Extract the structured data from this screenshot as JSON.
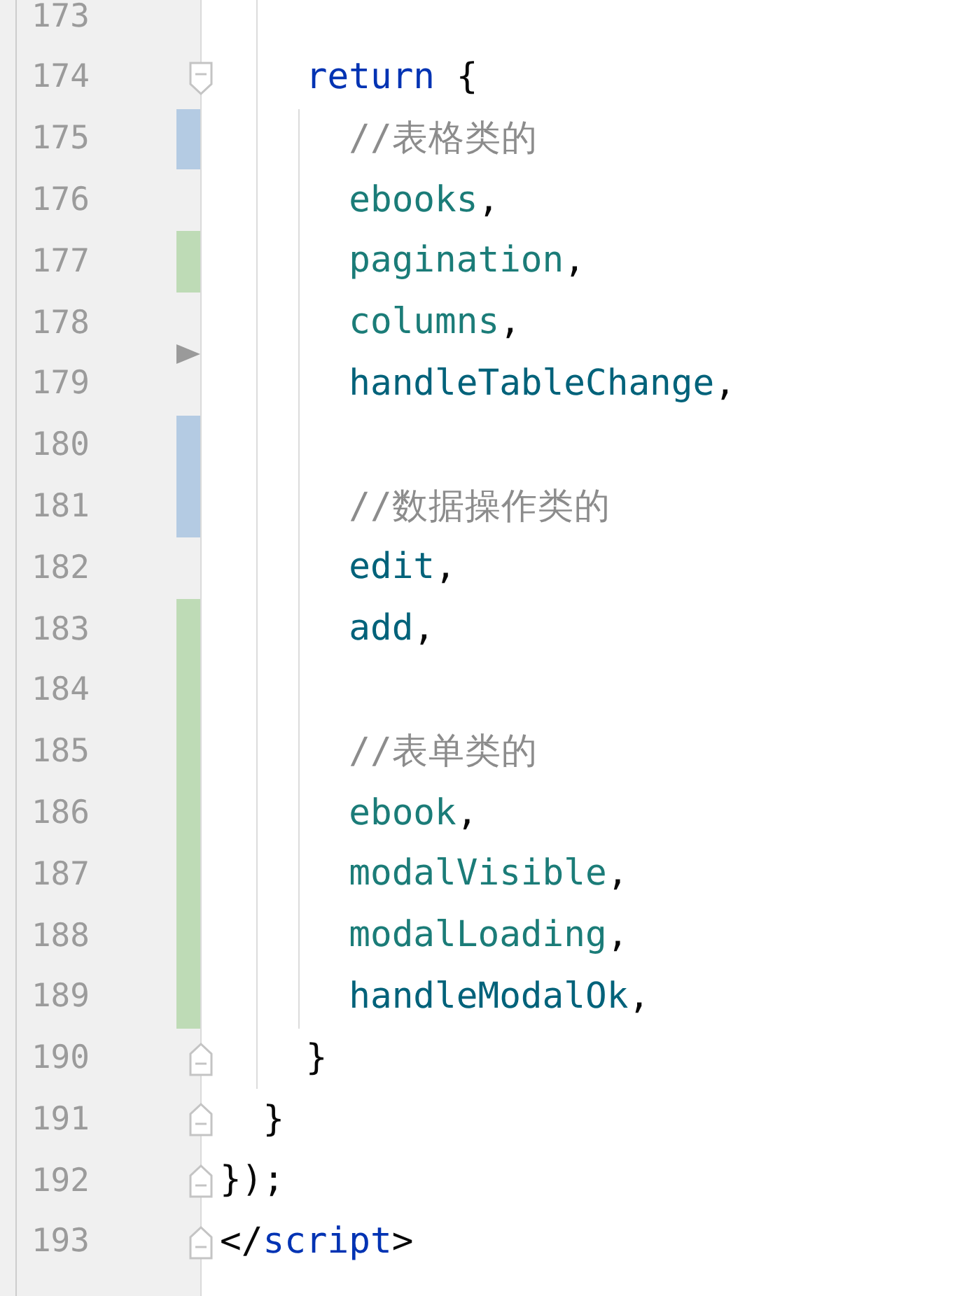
{
  "lines": [
    {
      "children": [
        {
          "children": [
            {
              "number": "173",
              "kind": "plain"
            },
            {
              "number": "174",
              "kind": "foldstart",
              "tokens": [
                {
                  "kind": "keyword",
                  "text": "return"
                },
                {
                  "kind": "plain",
                  "text": " {"
                }
              ],
              "children": [
                {
                  "number": "175",
                  "kind": "modified",
                  "tokens": [
                    {
                      "kind": "comment",
                      "text": "//表格类的"
                    }
                  ]
                },
                {
                  "number": "176",
                  "kind": "plain",
                  "tokens": [
                    {
                      "kind": "variable",
                      "text": "ebooks"
                    },
                    {
                      "kind": "plain",
                      "text": ","
                    }
                  ]
                },
                {
                  "number": "177",
                  "kind": "added",
                  "tokens": [
                    {
                      "kind": "variable",
                      "text": "pagination"
                    },
                    {
                      "kind": "plain",
                      "text": ","
                    }
                  ]
                },
                {
                  "number": "178",
                  "kind": "deleted",
                  "tokens": [
                    {
                      "kind": "variable",
                      "text": "columns"
                    },
                    {
                      "kind": "plain",
                      "text": ","
                    }
                  ]
                },
                {
                  "number": "179",
                  "kind": "plain",
                  "tokens": [
                    {
                      "kind": "function",
                      "text": "handleTableChange"
                    },
                    {
                      "kind": "plain",
                      "text": ","
                    }
                  ]
                },
                {
                  "number": "180",
                  "kind": "modified"
                },
                {
                  "number": "181",
                  "kind": "modified",
                  "tokens": [
                    {
                      "kind": "comment",
                      "text": "//数据操作类的"
                    }
                  ]
                },
                {
                  "number": "182",
                  "kind": "plain",
                  "tokens": [
                    {
                      "kind": "function",
                      "text": "edit"
                    },
                    {
                      "kind": "plain",
                      "text": ","
                    }
                  ]
                },
                {
                  "number": "183",
                  "kind": "added",
                  "tokens": [
                    {
                      "kind": "function",
                      "text": "add"
                    },
                    {
                      "kind": "plain",
                      "text": ","
                    }
                  ]
                },
                {
                  "number": "184",
                  "kind": "added"
                },
                {
                  "number": "185",
                  "kind": "added",
                  "tokens": [
                    {
                      "kind": "comment",
                      "text": "//表单类的"
                    }
                  ]
                },
                {
                  "number": "186",
                  "kind": "added",
                  "tokens": [
                    {
                      "kind": "variable",
                      "text": "ebook"
                    },
                    {
                      "kind": "plain",
                      "text": ","
                    }
                  ]
                },
                {
                  "number": "187",
                  "kind": "added",
                  "tokens": [
                    {
                      "kind": "variable",
                      "text": "modalVisible"
                    },
                    {
                      "kind": "plain",
                      "text": ","
                    }
                  ]
                },
                {
                  "number": "188",
                  "kind": "added",
                  "tokens": [
                    {
                      "kind": "variable",
                      "text": "modalLoading"
                    },
                    {
                      "kind": "plain",
                      "text": ","
                    }
                  ]
                },
                {
                  "number": "189",
                  "kind": "added",
                  "tokens": [
                    {
                      "kind": "function",
                      "text": "handleModalOk"
                    },
                    {
                      "kind": "plain",
                      "text": ","
                    }
                  ]
                }
              ]
            },
            {
              "number": "190",
              "kind": "foldend",
              "tokens": [
                {
                  "kind": "plain",
                  "text": "}"
                }
              ]
            }
          ]
        },
        {
          "number": "191",
          "kind": "foldend",
          "tokens": [
            {
              "kind": "plain",
              "text": "}"
            }
          ]
        }
      ]
    },
    {
      "number": "192",
      "kind": "foldend",
      "tokens": [
        {
          "kind": "plain",
          "text": "});"
        }
      ]
    },
    {
      "number": "193",
      "kind": "foldend",
      "tokens": [
        {
          "kind": "plain",
          "text": "</"
        },
        {
          "kind": "tag",
          "text": "script"
        },
        {
          "kind": "plain",
          "text": ">"
        }
      ]
    }
  ]
}
